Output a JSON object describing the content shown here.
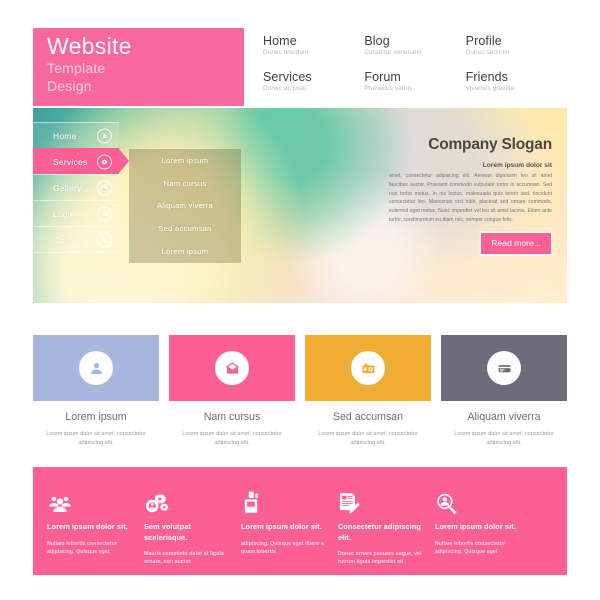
{
  "brand": {
    "line1": "Website",
    "line2": "Template",
    "line3": "Design",
    "color": "#f9689a"
  },
  "nav": {
    "items": [
      {
        "title": "Home",
        "subtitle": "Donec tincidunt"
      },
      {
        "title": "Blog",
        "subtitle": "Curabitur venenatis"
      },
      {
        "title": "Profile",
        "subtitle": "Donec sed nisi"
      },
      {
        "title": "Services",
        "subtitle": "Donec ac justo"
      },
      {
        "title": "Forum",
        "subtitle": "Phasellus varius"
      },
      {
        "title": "Friends",
        "subtitle": "Vivamus gravida"
      }
    ]
  },
  "hero": {
    "sidebar": [
      {
        "label": "Home",
        "icon": "home-icon",
        "active": false
      },
      {
        "label": "Services",
        "icon": "gear-icon",
        "active": true
      },
      {
        "label": "Gallery",
        "icon": "image-icon",
        "active": false
      },
      {
        "label": "Login",
        "icon": "login-icon",
        "active": false
      },
      {
        "label": "Contact",
        "icon": "phone-icon",
        "active": false
      }
    ],
    "submenu": [
      "Lorem ipsum",
      "Nam cursus",
      "Aliquam viverra",
      "Sed accumsan",
      "Lorem ipsum"
    ],
    "slogan_title": "Company Slogan",
    "slogan_lead": "Lorem ipsum dolor sit",
    "slogan_body": "amet, consectetur adipiscing elit. Aenean dignissim leo sit amet faucibus auctor. Praesent commodo vulputate tortor in accumsan. Sed non tortor metus. In nis lectus, malesuada quis lorem sed, tincidunt consectetur leo. Maecenas orci nibh, placerat sed ornare commodo, euismod eget metus. Nunc imperdiet vel leo sit amet lacinia. Etiam ante tortor, condimentum eu diam nec, semper congue felis.",
    "read_more": "Read more...",
    "accent": "#fb5f93"
  },
  "cards": [
    {
      "title": "Lorem ipsum",
      "desc": "Lorem ipsum dolor sit amet, consectetur adipiscing elit.",
      "color": "#a8b6dd",
      "icon": "user-icon"
    },
    {
      "title": "Nam cursus",
      "desc": "Lorem ipsum dolor sit amet, consectetur adipiscing elit.",
      "color": "#fb5f93",
      "icon": "envelope-icon"
    },
    {
      "title": "Sed accumsan",
      "desc": "Lorem ipsum dolor sit amet, consectetur adipiscing elit.",
      "color": "#efad33",
      "icon": "camera-icon"
    },
    {
      "title": "Aliquam viverra",
      "desc": "Lorem ipsum dolor sit amet, consectetur adipiscing elit.",
      "color": "#6e6c7a",
      "icon": "credit-card-icon"
    }
  ],
  "footer": {
    "background": "#fb5f93",
    "columns": [
      {
        "icon": "people-group-icon",
        "title": "Lorem ipsum dolor sit.",
        "body": "Nullam lobortis consectetur adipiscing. Quisque eget"
      },
      {
        "icon": "gears-icon",
        "title": "Sem volutpat scelerisque.",
        "body": "Mauris commodo dolor et ligula ornare, non auctor"
      },
      {
        "icon": "printer-icon",
        "title": "Lorem ipsum dolor sit.",
        "body": "adipiscing. Quisque eget libero a quam lobortis"
      },
      {
        "icon": "document-edit-icon",
        "title": "Consectetur adipiscing elit.",
        "body": "Donec ornare posuere augue, vel rutrum ligula imperdiet sit"
      },
      {
        "icon": "user-search-icon",
        "title": "Lorem ipsum dolor sit.",
        "body": "Nullam lobortis consectetur adipiscing. Quisque eget"
      }
    ]
  }
}
